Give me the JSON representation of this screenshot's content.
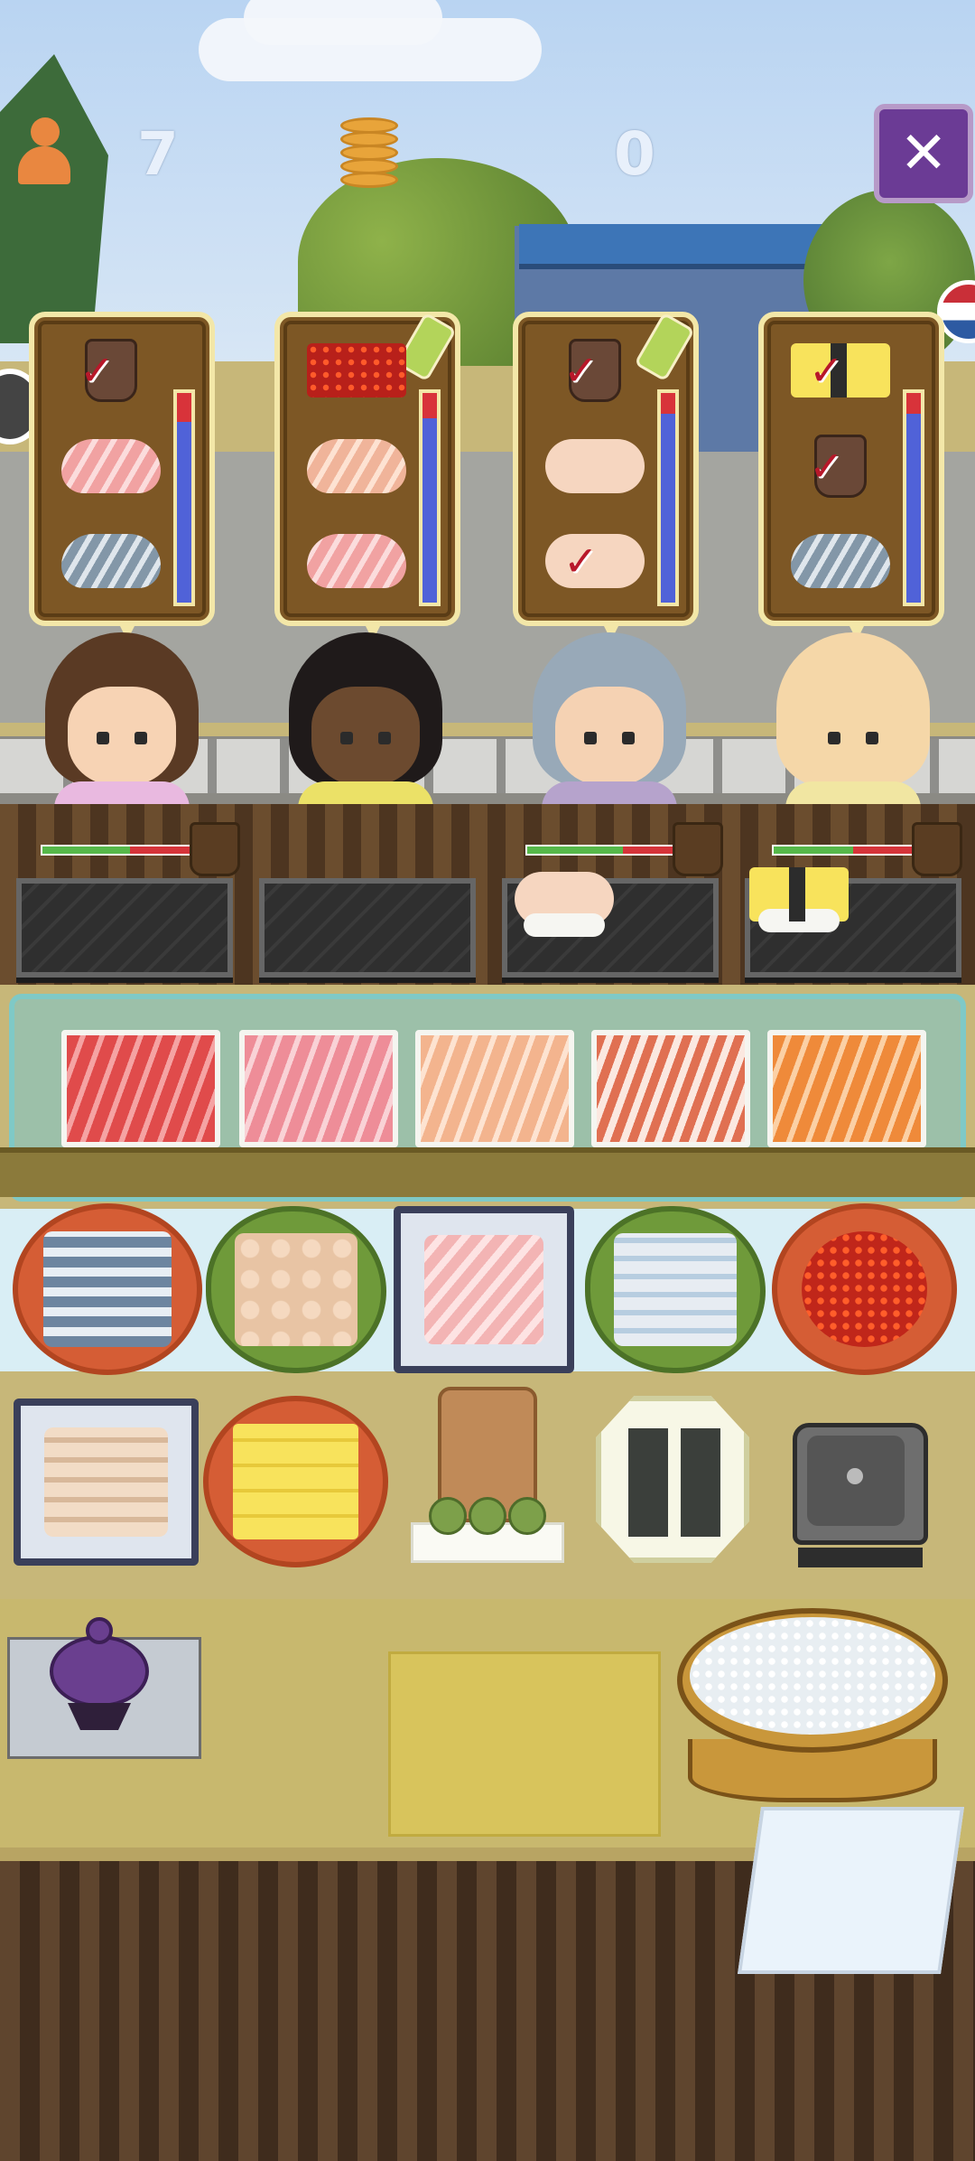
{
  "hud": {
    "customers_icon": "person-icon",
    "customers_served": "7",
    "coins_icon": "coin-stack-icon",
    "coins": "0",
    "close_label": "✕"
  },
  "orders": [
    {
      "customer": "girl-in-pink-kimono",
      "patience": 0.86,
      "items": [
        {
          "type": "tea",
          "done": true
        },
        {
          "type": "tuna-nigiri",
          "done": false
        },
        {
          "type": "mackerel-nigiri",
          "done": false
        }
      ]
    },
    {
      "customer": "woman-in-yellow",
      "patience": 0.88,
      "wasabi": true,
      "items": [
        {
          "type": "ikura",
          "done": false
        },
        {
          "type": "salmon-nigiri",
          "done": false
        },
        {
          "type": "tuna-nigiri",
          "done": false
        }
      ]
    },
    {
      "customer": "grandmother",
      "patience": 0.9,
      "wasabi": true,
      "items": [
        {
          "type": "tea",
          "done": true
        },
        {
          "type": "scallop-nigiri",
          "done": false
        },
        {
          "type": "scallop-nigiri",
          "done": true
        }
      ]
    },
    {
      "customer": "bald-man",
      "patience": 0.9,
      "items": [
        {
          "type": "tamago-nigiri",
          "done": true
        },
        {
          "type": "tea",
          "done": true
        },
        {
          "type": "mackerel-nigiri",
          "done": false
        }
      ]
    }
  ],
  "customer_meters": [
    0.55,
    null,
    0.6,
    0.5
  ],
  "served_plates": [
    null,
    null,
    "scallop-nigiri",
    "tamago-nigiri"
  ],
  "display_case": [
    "tuna",
    "fatty-tuna",
    "yellowtail",
    "shrimp",
    "salmon"
  ],
  "ingredients_row1": [
    "mackerel",
    "scallop",
    "sea-bream",
    "squid",
    "salmon-roe"
  ],
  "ingredients_row2": [
    "shrimp",
    "tamago"
  ],
  "tools": [
    "wasabi-board",
    "nori-box",
    "rice-cooker",
    "trash-pot",
    "rolling-mat",
    "rice-tub",
    "hand-towel"
  ]
}
